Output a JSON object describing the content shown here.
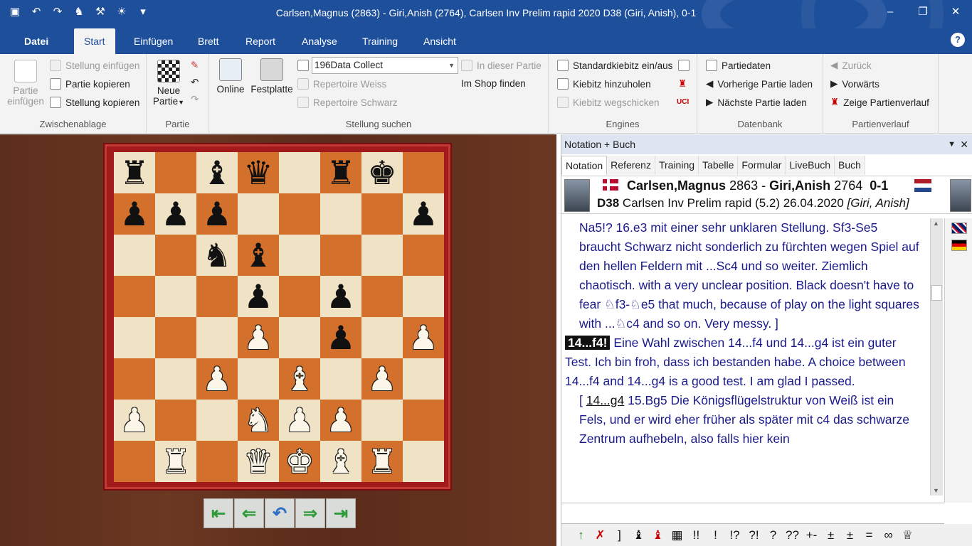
{
  "window": {
    "title": "Carlsen,Magnus (2863) - Giri,Anish (2764), Carlsen Inv Prelim rapid 2020  D38  (Giri, Anish), 0-1"
  },
  "quick_access": [
    "save-icon",
    "undo-icon",
    "redo-icon",
    "engine-icon",
    "tools-icon",
    "bulb-icon",
    "customize-icon"
  ],
  "ribbon_tabs": [
    "Datei",
    "Start",
    "Einfügen",
    "Brett",
    "Report",
    "Analyse",
    "Training",
    "Ansicht"
  ],
  "ribbon": {
    "zwischenablage": {
      "label": "Zwischenablage",
      "paste_game_1": "Partie",
      "paste_game_2": "einfügen",
      "paste_position": "Stellung einfügen",
      "copy_game": "Partie kopieren",
      "copy_position": "Stellung kopieren"
    },
    "partie": {
      "label": "Partie",
      "new_game_1": "Neue",
      "new_game_2": "Partie"
    },
    "stellung": {
      "label": "Stellung suchen",
      "online": "Online",
      "disk": "Festplatte",
      "database": "196Data Collect",
      "in_game": "In dieser Partie",
      "repertoire_white": "Repertoire Weiss",
      "repertoire_black": "Repertoire Schwarz",
      "shop": "Im Shop finden"
    },
    "engines": {
      "label": "Engines",
      "standard": "Standardkiebitz ein/aus",
      "add": "Kiebitz hinzuholen",
      "remove": "Kiebitz wegschicken",
      "uci": "UCI"
    },
    "datenbank": {
      "label": "Datenbank",
      "game_data": "Partiedaten",
      "prev_game": "Vorherige Partie laden",
      "next_game": "Nächste Partie laden"
    },
    "verlauf": {
      "label": "Partienverlauf",
      "back": "Zurück",
      "forward": "Vorwärts",
      "show": "Zeige Partienverlauf"
    }
  },
  "board": {
    "rows": [
      [
        "r",
        "",
        "b",
        "q",
        "",
        "r",
        "k",
        ""
      ],
      [
        "p",
        "p",
        "p",
        "",
        "",
        "",
        "",
        "p"
      ],
      [
        "",
        "",
        "n",
        "b",
        "",
        "",
        "",
        ""
      ],
      [
        "",
        "",
        "",
        "p",
        "",
        "p",
        "",
        ""
      ],
      [
        "",
        "",
        "",
        "P",
        "",
        "p",
        "",
        "P"
      ],
      [
        "",
        "",
        "P",
        "",
        "B",
        "",
        "P",
        ""
      ],
      [
        "P",
        "",
        "",
        "N",
        "P",
        "P",
        "",
        ""
      ],
      [
        "",
        "R",
        "",
        "Q",
        "K",
        "B",
        "R",
        ""
      ]
    ]
  },
  "nav_buttons": [
    "first-move",
    "previous-move",
    "take-back",
    "next-move",
    "last-move"
  ],
  "panel": {
    "title": "Notation + Buch",
    "tabs": [
      "Notation",
      "Referenz",
      "Training",
      "Tabelle",
      "Formular",
      "LiveBuch",
      "Buch"
    ],
    "white_player": "Carlsen,Magnus",
    "white_elo": "2863",
    "separator": "-",
    "black_player": "Giri,Anish",
    "black_elo": "2764",
    "result": "0-1",
    "eco": "D38",
    "event": "Carlsen Inv Prelim rapid (5.2) 26.04.2020",
    "annotator": "[Giri, Anish]"
  },
  "notation": {
    "p1": "Na5!?  16.e3 mit einer sehr unklaren Stellung. Sf3-Se5 braucht Schwarz nicht sonderlich zu fürchten wegen Spiel auf den hellen Feldern mit ...Sc4 und so weiter. Ziemlich chaotisch. with a very unclear position. Black doesn't have to fear ♘f3-♘e5 that much, because of play on the light squares with ...♘c4 and so on. Very messy. ]",
    "current_move": "14...f4!",
    "p2": " Eine Wahl zwischen 14...f4 und 14...g4 ist ein guter Test. Ich bin froh, dass ich bestanden habe. A choice between 14...f4 and 14...g4 is a good test. I am glad I passed.",
    "p3_open": "[ ",
    "p3_move": "14...g4",
    "p3_text": "  15.Bg5 Die Königsflügelstruktur von Weiß ist ein Fels, und er wird eher früher als später mit c4 das schwarze Zentrum aufhebeln, also falls hier kein"
  },
  "symbols": [
    "↑",
    "✗",
    "]",
    "♝",
    "♝",
    "▦",
    "!!",
    "!",
    "!?",
    "?!",
    "?",
    "??",
    "+-",
    "±",
    "±",
    "=",
    "∞",
    "♕"
  ],
  "colors": {
    "titlebar": "#1e4f9b",
    "board_light": "#f0e2c4",
    "board_dark": "#d2702c",
    "frame": "#a21a1c",
    "notation_text": "#1a1a8c"
  }
}
